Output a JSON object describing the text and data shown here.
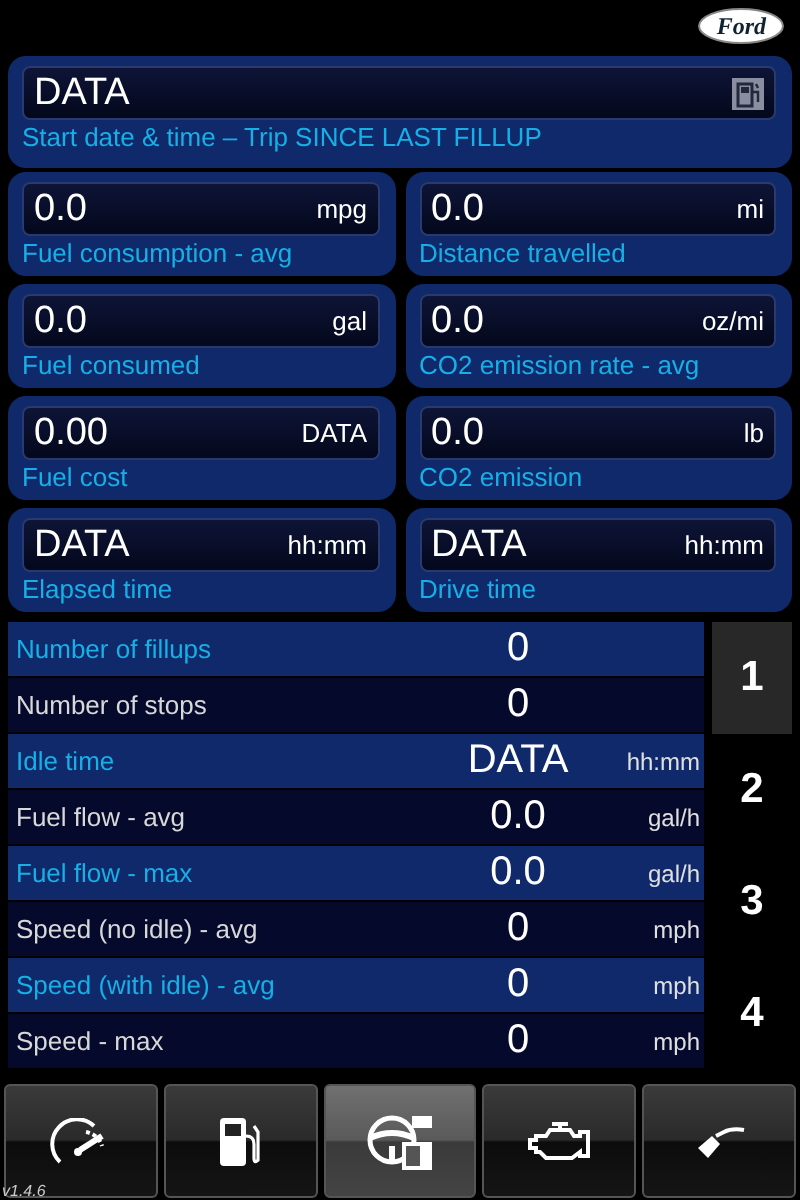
{
  "logo": {
    "text": "Ford"
  },
  "trip": {
    "value": "DATA",
    "label": "Start date & time – Trip SINCE LAST FILLUP"
  },
  "cards": [
    {
      "value": "0.0",
      "unit": "mpg",
      "label": "Fuel consumption - avg"
    },
    {
      "value": "0.0",
      "unit": "mi",
      "label": "Distance travelled"
    },
    {
      "value": "0.0",
      "unit": "gal",
      "label": "Fuel consumed"
    },
    {
      "value": "0.0",
      "unit": "oz/mi",
      "label": "CO2 emission rate - avg"
    },
    {
      "value": "0.00",
      "unit": "DATA",
      "label": "Fuel cost"
    },
    {
      "value": "0.0",
      "unit": "lb",
      "label": "CO2 emission"
    },
    {
      "value": "DATA",
      "unit": "hh:mm",
      "label": "Elapsed time"
    },
    {
      "value": "DATA",
      "unit": "hh:mm",
      "label": "Drive time"
    }
  ],
  "table": {
    "rows": [
      {
        "label": "Number of fillups",
        "value": "0",
        "highlighted": true
      },
      {
        "label": "Number of stops",
        "value": "0",
        "highlighted": false
      },
      {
        "label": "Idle time",
        "value": "DATA",
        "unit": "hh:mm",
        "highlighted": true
      },
      {
        "label": "Fuel flow - avg",
        "value": "0.0",
        "unit": "gal/h",
        "highlighted": false
      },
      {
        "label": "Fuel flow - max",
        "value": "0.0",
        "unit": "gal/h",
        "highlighted": true
      },
      {
        "label": "Speed (no idle) - avg",
        "value": "0",
        "unit": "mph",
        "highlighted": false
      },
      {
        "label": "Speed (with idle) - avg",
        "value": "0",
        "unit": "mph",
        "highlighted": true
      },
      {
        "label": "Speed - max",
        "value": "0",
        "unit": "mph",
        "highlighted": false
      }
    ]
  },
  "pages": [
    {
      "label": "1",
      "selected": true
    },
    {
      "label": "2",
      "selected": false
    },
    {
      "label": "3",
      "selected": false
    },
    {
      "label": "4",
      "selected": false
    }
  ],
  "tabs": [
    {
      "kind": "gauge",
      "selected": false
    },
    {
      "kind": "pump",
      "selected": false
    },
    {
      "kind": "wheel",
      "selected": true
    },
    {
      "kind": "engine",
      "selected": false
    },
    {
      "kind": "nozzle",
      "selected": false
    }
  ],
  "version": "v1.4.6"
}
